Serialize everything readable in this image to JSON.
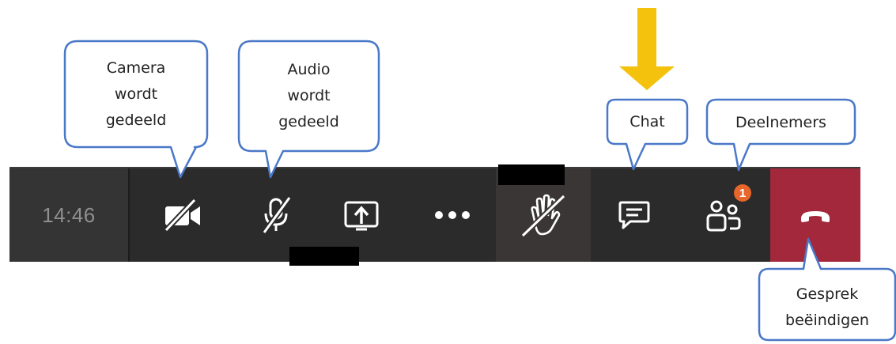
{
  "toolbar": {
    "timer": "14:46",
    "buttons": [
      {
        "name": "camera",
        "icon": "camera-off-icon"
      },
      {
        "name": "microphone",
        "icon": "mic-off-icon"
      },
      {
        "name": "share",
        "icon": "share-screen-icon"
      },
      {
        "name": "more",
        "icon": "more-dots-icon"
      },
      {
        "name": "raise-hand",
        "icon": "hand-off-icon"
      },
      {
        "name": "chat",
        "icon": "chat-icon"
      },
      {
        "name": "participants",
        "icon": "participants-icon"
      },
      {
        "name": "hang-up",
        "icon": "phone-hangup-icon"
      }
    ],
    "participants_badge": "1"
  },
  "callouts": {
    "camera": "Camera\nwordt\ngedeeld",
    "audio": "Audio\nwordt\ngedeeld",
    "chat": "Chat",
    "participants": "Deelnemers",
    "hangup": "Gesprek\nbeëindigen"
  },
  "colors": {
    "toolbar_bg": "#2b2b2b",
    "hangup_bg": "#a3283b",
    "callout_border": "#4a78c8",
    "arrow": "#f4c20d",
    "badge": "#e7662b"
  }
}
